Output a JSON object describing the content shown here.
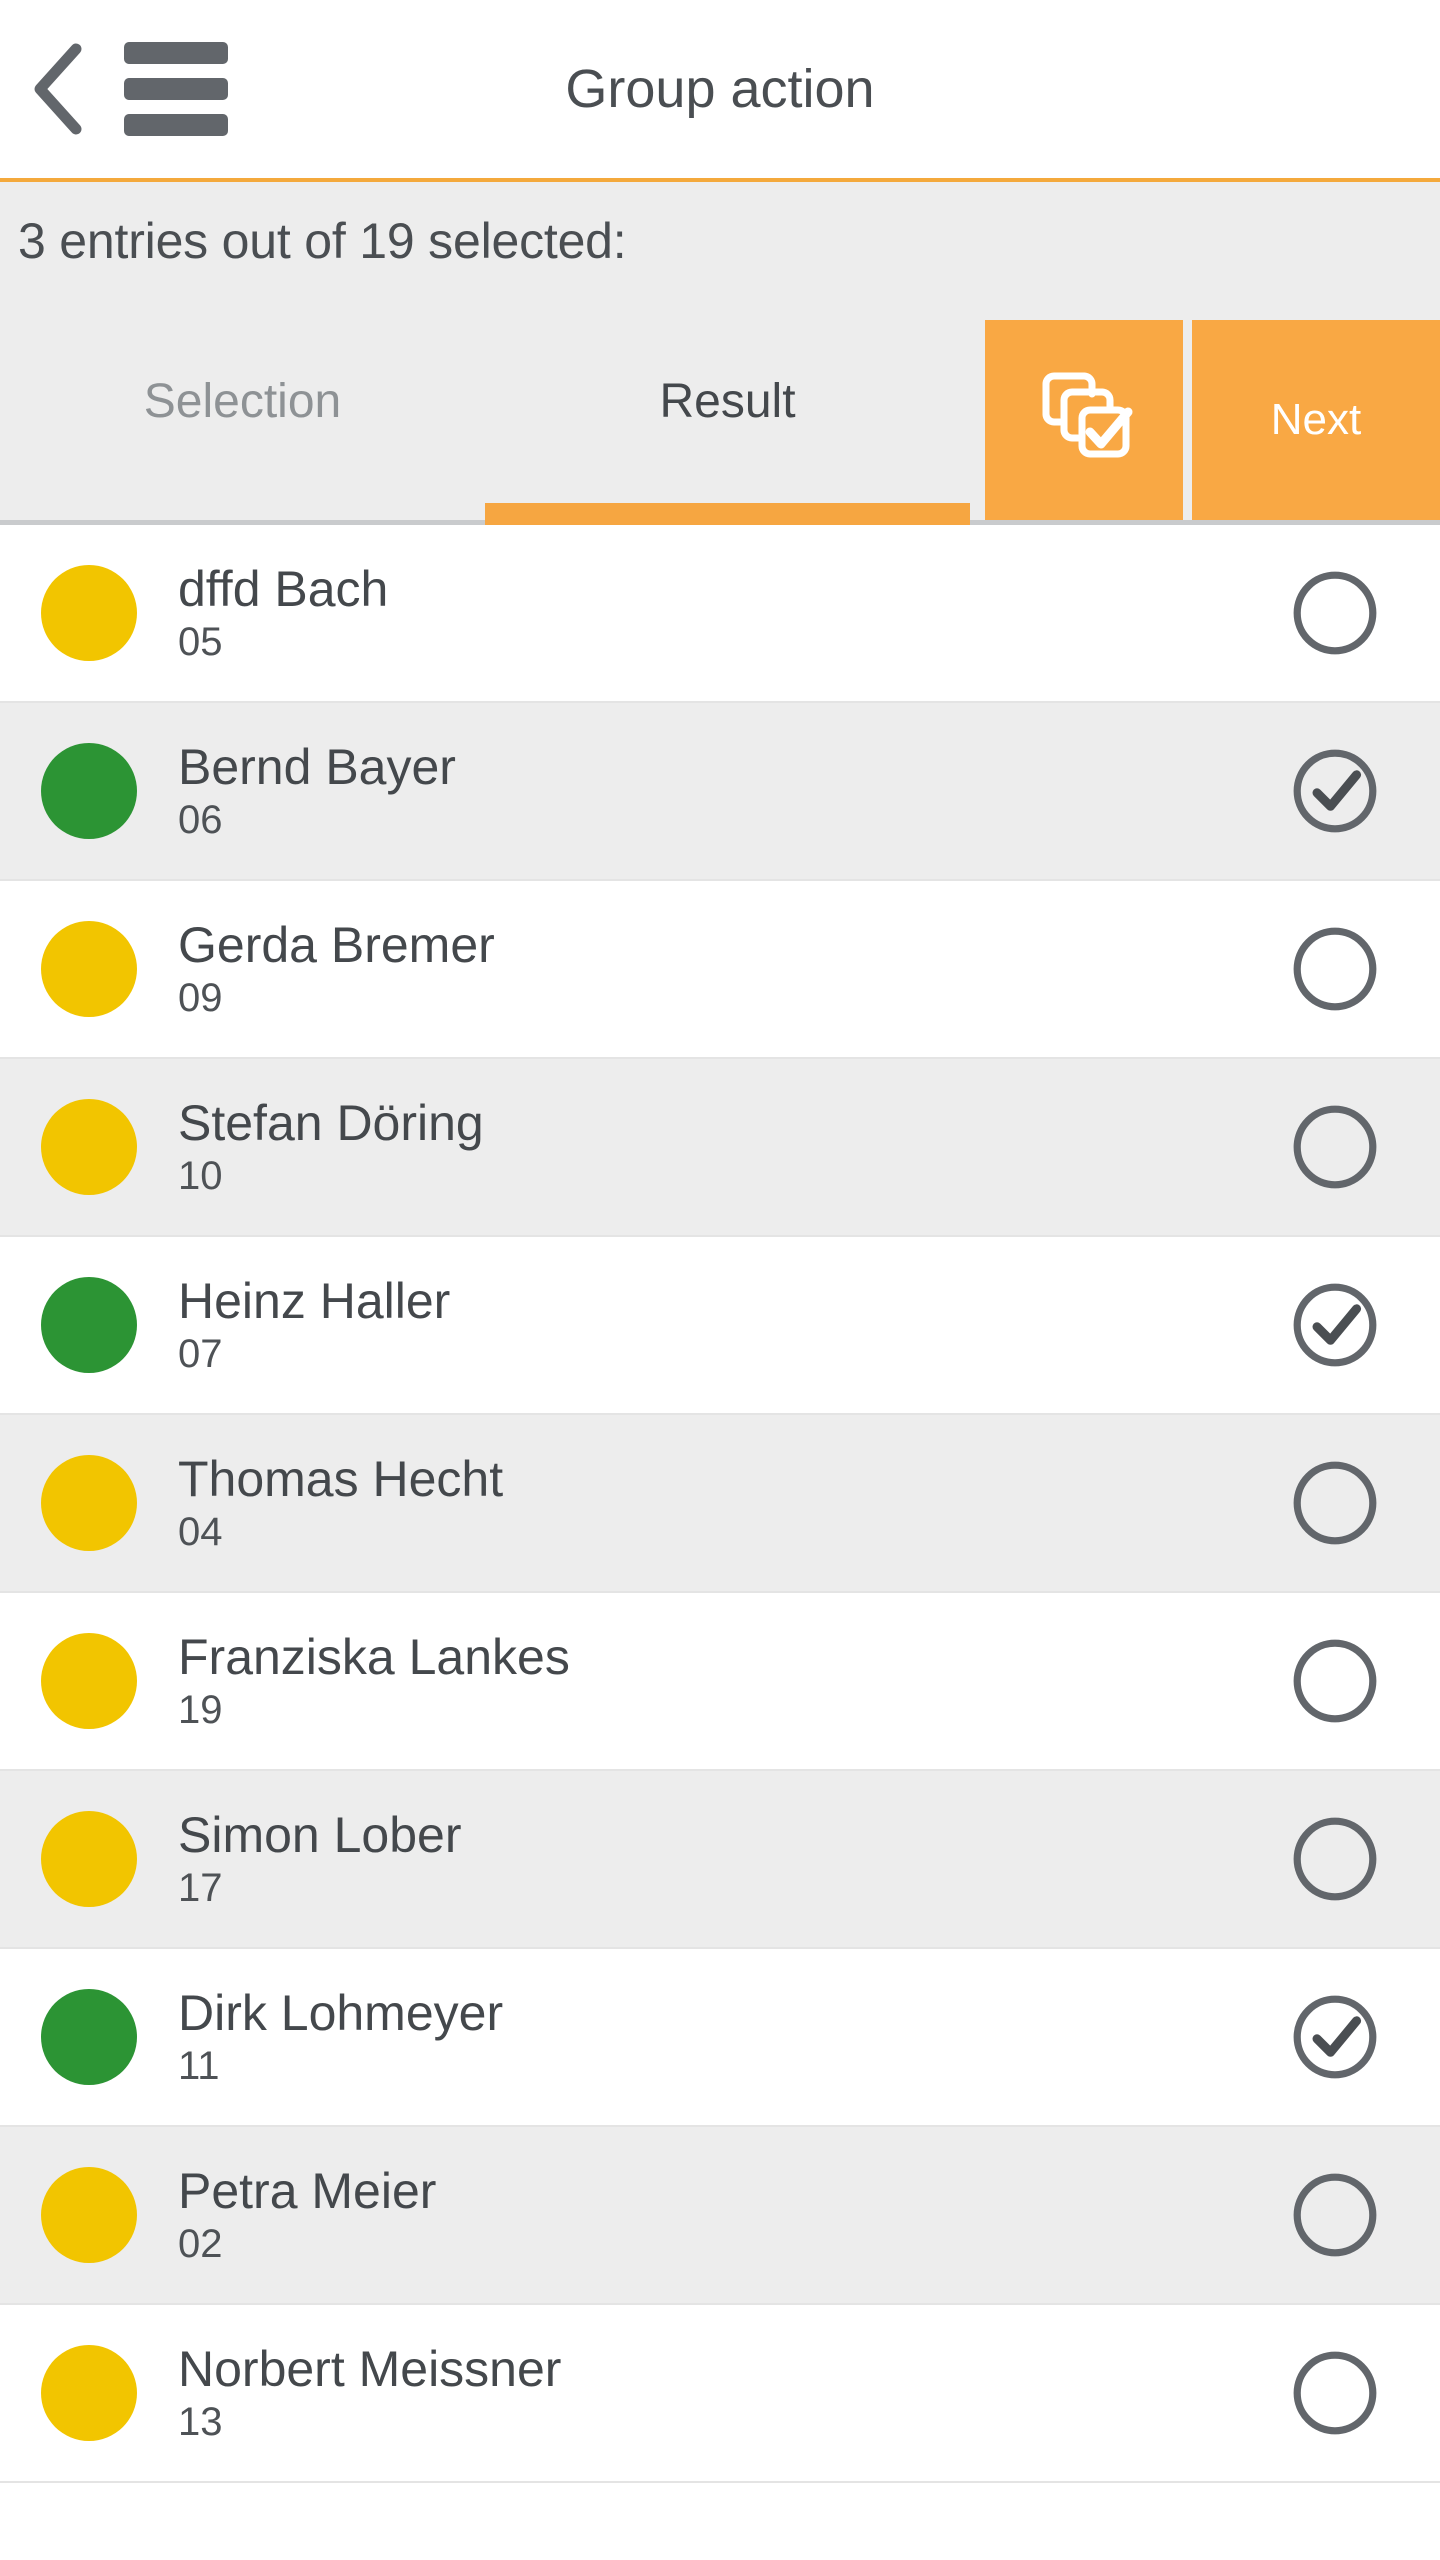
{
  "header": {
    "title": "Group action",
    "back_icon": "chevron-left-icon",
    "menu_icon": "hamburger-menu-icon",
    "accent_color": "#F4A93C"
  },
  "selection": {
    "summary": "3 entries out of 19 selected:",
    "selected_count": 3,
    "total_count": 19
  },
  "tabs": {
    "items": [
      {
        "label": "Selection",
        "active": false
      },
      {
        "label": "Result",
        "active": true
      }
    ],
    "active_indicator_color": "#F6A641"
  },
  "toolbar": {
    "multi_select_label": "",
    "multi_select_icon": "copy-check-icon",
    "next_label": "Next",
    "button_color": "#F9A844"
  },
  "colors": {
    "status_yellow": "#F2C500",
    "status_green": "#2C9434",
    "row_alt_background": "#EDEDED",
    "row_background": "#FFFFFF",
    "text_primary": "#44484C",
    "text_muted": "#8E9295"
  },
  "list": {
    "rows": [
      {
        "name": "dffd Bach",
        "code": "05",
        "status": "yellow",
        "checked": false
      },
      {
        "name": "Bernd Bayer",
        "code": "06",
        "status": "green",
        "checked": true
      },
      {
        "name": "Gerda Bremer",
        "code": "09",
        "status": "yellow",
        "checked": false
      },
      {
        "name": "Stefan Döring",
        "code": "10",
        "status": "yellow",
        "checked": false
      },
      {
        "name": "Heinz Haller",
        "code": "07",
        "status": "green",
        "checked": true
      },
      {
        "name": "Thomas Hecht",
        "code": "04",
        "status": "yellow",
        "checked": false
      },
      {
        "name": "Franziska Lankes",
        "code": "19",
        "status": "yellow",
        "checked": false
      },
      {
        "name": "Simon Lober",
        "code": "17",
        "status": "yellow",
        "checked": false
      },
      {
        "name": "Dirk Lohmeyer",
        "code": "11",
        "status": "green",
        "checked": true
      },
      {
        "name": "Petra Meier",
        "code": "02",
        "status": "yellow",
        "checked": false
      },
      {
        "name": "Norbert Meissner",
        "code": "13",
        "status": "yellow",
        "checked": false
      }
    ]
  }
}
